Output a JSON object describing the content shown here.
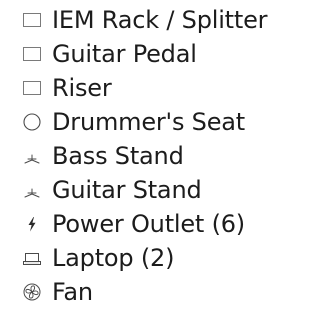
{
  "legend": {
    "items": [
      {
        "icon": "square-outline-icon",
        "label": "IEM Rack / Splitter"
      },
      {
        "icon": "square-outline-icon",
        "label": "Guitar Pedal"
      },
      {
        "icon": "square-outline-icon",
        "label": "Riser"
      },
      {
        "icon": "circle-outline-icon",
        "label": "Drummer's Seat"
      },
      {
        "icon": "stand-icon",
        "label": "Bass Stand"
      },
      {
        "icon": "stand-icon",
        "label": "Guitar Stand"
      },
      {
        "icon": "lightning-bolt-icon",
        "label": "Power Outlet (6)"
      },
      {
        "icon": "laptop-icon",
        "label": "Laptop (2)"
      },
      {
        "icon": "fan-icon",
        "label": "Fan"
      }
    ]
  }
}
